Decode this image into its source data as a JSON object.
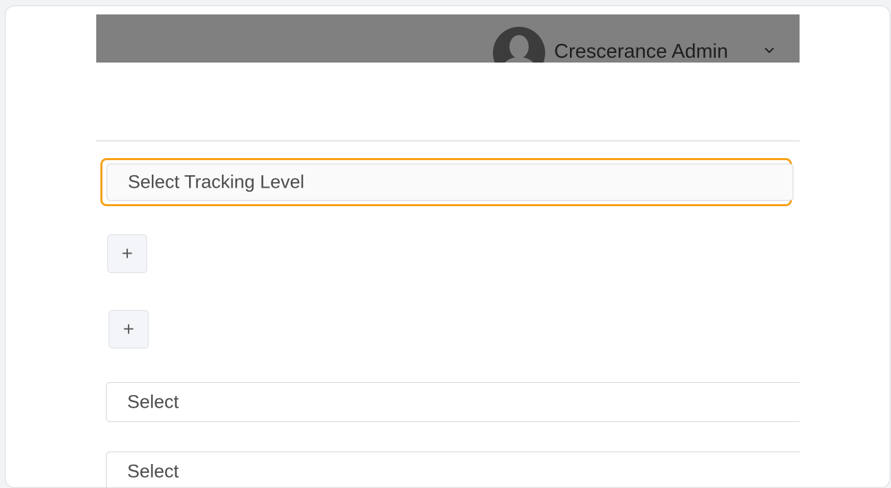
{
  "header": {
    "user_name": "Crescerance Admin",
    "avatar_icon": "user-avatar-icon",
    "dropdown_icon": "chevron-down-icon"
  },
  "form": {
    "tracking_select": {
      "placeholder": "Select Tracking Level"
    },
    "add_buttons": [
      {
        "label": "+"
      },
      {
        "label": "+"
      }
    ],
    "selects": [
      {
        "placeholder": "Select"
      },
      {
        "placeholder": "Select"
      }
    ]
  },
  "colors": {
    "highlight": "#f7a11a",
    "topbar": "#808080"
  }
}
